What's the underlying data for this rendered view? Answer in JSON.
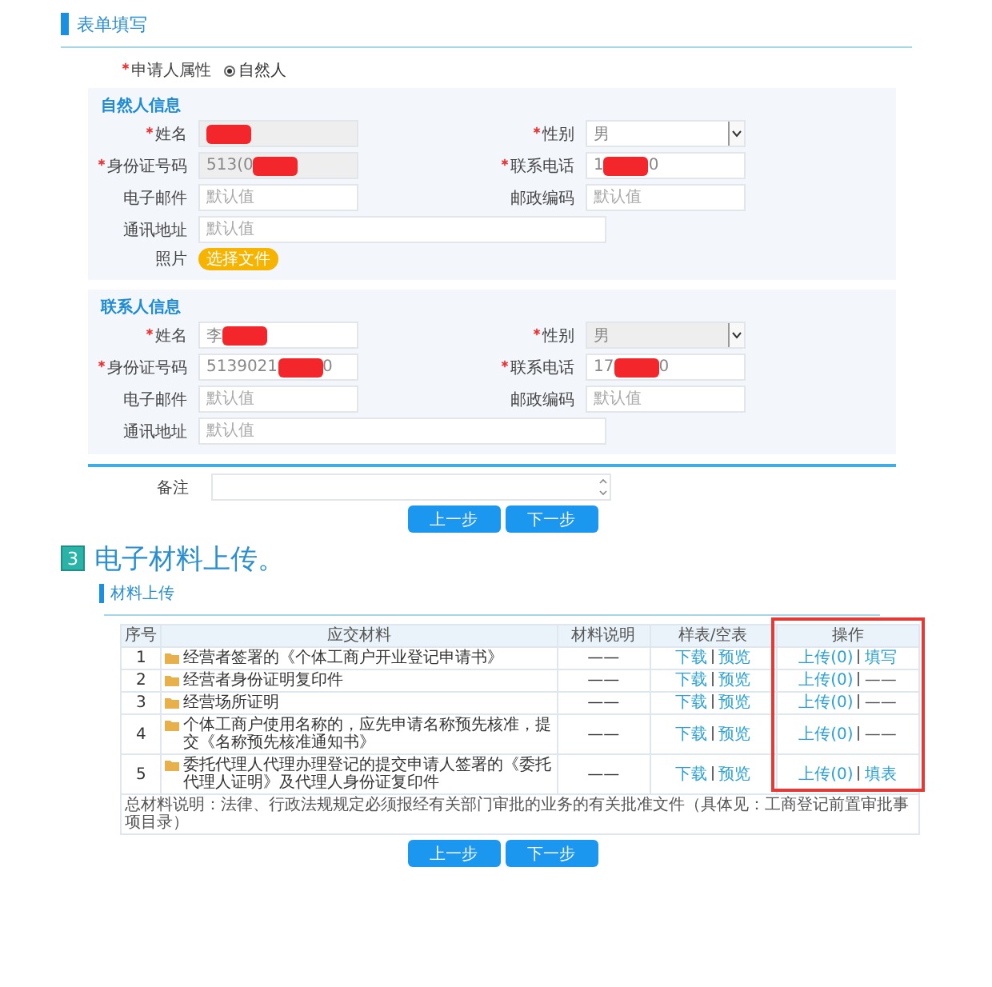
{
  "form_section": {
    "title": "表单填写",
    "applicant_type": {
      "label": "申请人属性",
      "required": true,
      "options": [
        {
          "label": "自然人",
          "selected": true
        }
      ]
    },
    "panels": [
      {
        "title": "自然人信息",
        "fields": [
          {
            "kind": "text",
            "label": "姓名",
            "required": true,
            "readonly": true,
            "redacted": true
          },
          {
            "kind": "select",
            "label": "性别",
            "required": true,
            "readonly": false,
            "value": "男"
          },
          {
            "kind": "text",
            "label": "身份证号码",
            "required": true,
            "readonly": true,
            "value": "513(0",
            "redacted": true
          },
          {
            "kind": "text",
            "label": "联系电话",
            "required": true,
            "readonly": false,
            "value": "1",
            "redacted": true,
            "value_after": "0"
          },
          {
            "kind": "text",
            "label": "电子邮件",
            "required": false,
            "readonly": false,
            "placeholder": "默认值"
          },
          {
            "kind": "text",
            "label": "邮政编码",
            "required": false,
            "readonly": false,
            "placeholder": "默认值"
          },
          {
            "kind": "wide",
            "label": "通讯地址",
            "required": false,
            "readonly": false,
            "placeholder": "默认值"
          },
          {
            "kind": "file",
            "label": "照片",
            "required": false,
            "button": "选择文件"
          }
        ]
      },
      {
        "title": "联系人信息",
        "fields": [
          {
            "kind": "text",
            "label": "姓名",
            "required": true,
            "readonly": false,
            "value": "李",
            "redacted": true
          },
          {
            "kind": "select",
            "label": "性别",
            "required": true,
            "readonly": true,
            "value": "男"
          },
          {
            "kind": "text",
            "label": "身份证号码",
            "required": true,
            "readonly": false,
            "value": "5139021",
            "redacted": true,
            "value_after": "0"
          },
          {
            "kind": "text",
            "label": "联系电话",
            "required": true,
            "readonly": false,
            "value": "17",
            "redacted": true,
            "value_after": "0"
          },
          {
            "kind": "text",
            "label": "电子邮件",
            "required": false,
            "readonly": false,
            "placeholder": "默认值"
          },
          {
            "kind": "text",
            "label": "邮政编码",
            "required": false,
            "readonly": false,
            "placeholder": "默认值"
          },
          {
            "kind": "wide",
            "label": "通讯地址",
            "required": false,
            "readonly": false,
            "placeholder": "默认值"
          }
        ]
      }
    ],
    "remarks_label": "备注",
    "buttons": [
      "上一步",
      "下一步"
    ]
  },
  "upload_section": {
    "step_number": "3",
    "title": "电子材料上传。",
    "subtitle": "材料上传",
    "table": {
      "columns": [
        {
          "label": "序号",
          "highlighted": false
        },
        {
          "label": "应交材料",
          "highlighted": false
        },
        {
          "label": "材料说明",
          "highlighted": false
        },
        {
          "label": "样表/空表",
          "highlighted": false
        },
        {
          "label": "操作",
          "highlighted": true
        }
      ],
      "rows": [
        {
          "number": "1",
          "material": "经营者签署的《个体工商户开业登记申请书》",
          "description": "——",
          "samples": [
            "下载",
            "预览"
          ],
          "actions": [
            {
              "kind": "link",
              "text": "上传(0)"
            },
            {
              "kind": "link",
              "text": "填写"
            }
          ]
        },
        {
          "number": "2",
          "material": "经营者身份证明复印件",
          "description": "——",
          "samples": [
            "下载",
            "预览"
          ],
          "actions": [
            {
              "kind": "link",
              "text": "上传(0)"
            },
            {
              "kind": "text",
              "text": "——"
            }
          ]
        },
        {
          "number": "3",
          "material": "经营场所证明",
          "description": "——",
          "samples": [
            "下载",
            "预览"
          ],
          "actions": [
            {
              "kind": "link",
              "text": "上传(0)"
            },
            {
              "kind": "text",
              "text": "——"
            }
          ]
        },
        {
          "number": "4",
          "material": "个体工商户使用名称的，应先申请名称预先核准，提交《名称预先核准通知书》",
          "description": "——",
          "samples": [
            "下载",
            "预览"
          ],
          "actions": [
            {
              "kind": "link",
              "text": "上传(0)"
            },
            {
              "kind": "text",
              "text": "——"
            }
          ]
        },
        {
          "number": "5",
          "material": "委托代理人代理办理登记的提交申请人签署的《委托代理人证明》及代理人身份证复印件",
          "description": "——",
          "samples": [
            "下载",
            "预览"
          ],
          "actions": [
            {
              "kind": "link",
              "text": "上传(0)"
            },
            {
              "kind": "link",
              "text": "填表"
            }
          ]
        }
      ],
      "note": "总材料说明：法律、行政法规规定必须报经有关部门审批的业务的有关批准文件（具体见：工商登记前置审批事项目录）"
    },
    "buttons": [
      "上一步",
      "下一步"
    ]
  }
}
